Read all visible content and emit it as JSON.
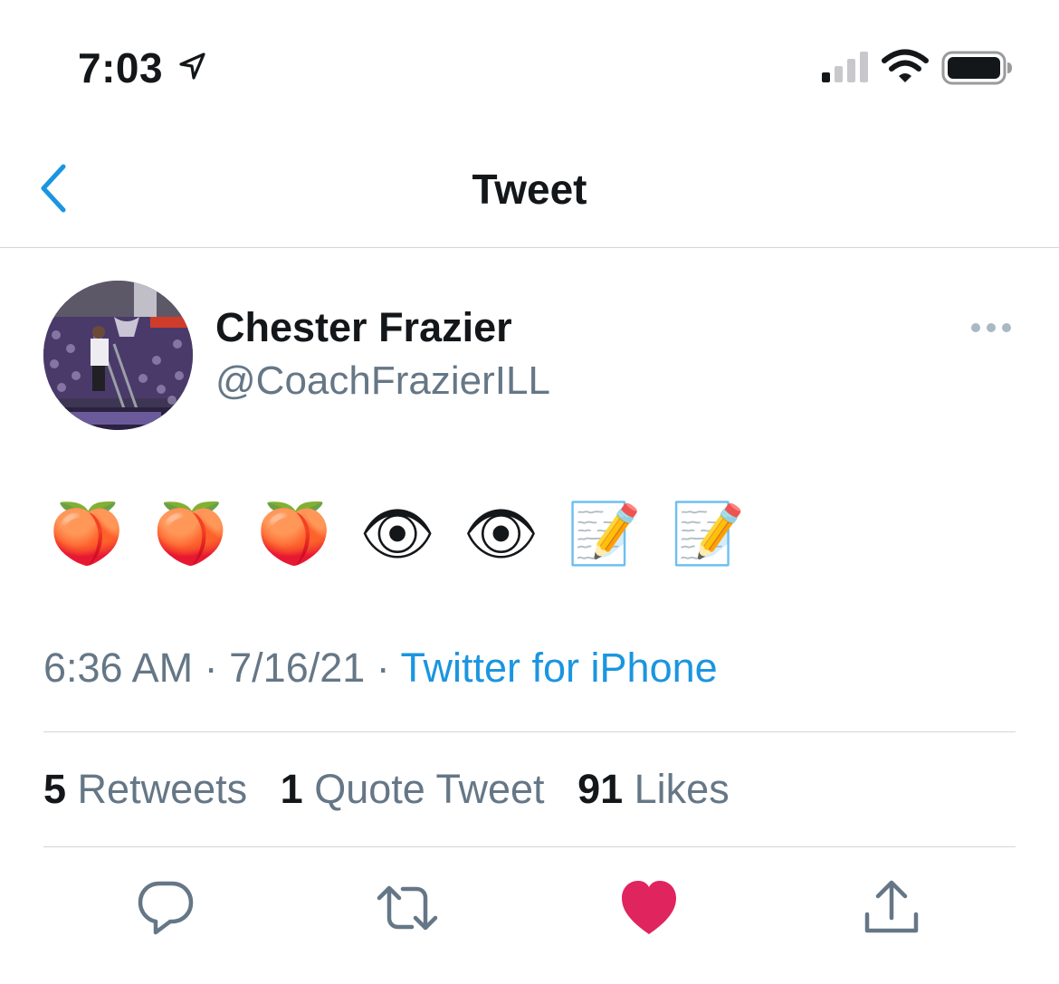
{
  "status_bar": {
    "time": "7:03",
    "location_icon": "location-arrow-icon",
    "signal_icon": "cellular-signal-icon",
    "wifi_icon": "wifi-icon",
    "battery_icon": "battery-icon"
  },
  "nav": {
    "back_icon": "chevron-left-icon",
    "title": "Tweet"
  },
  "tweet": {
    "author": {
      "name": "Chester Frazier",
      "handle": "@CoachFrazierILL"
    },
    "more_icon": "ellipsis-icon",
    "emojis": [
      "🍑",
      "🍑",
      "🍑",
      "👁",
      "👁",
      "📝",
      "📝"
    ],
    "time": "6:36 AM",
    "sep1": "·",
    "date": "7/16/21",
    "sep2": "·",
    "source": "Twitter for iPhone"
  },
  "stats": {
    "retweets_count": "5",
    "retweets_label": "Retweets",
    "quotes_count": "1",
    "quotes_label": "Quote Tweet",
    "likes_count": "91",
    "likes_label": "Likes"
  },
  "actions": {
    "reply_icon": "reply-bubble-icon",
    "retweet_icon": "retweet-icon",
    "like_icon": "heart-filled-icon",
    "share_icon": "share-icon"
  },
  "colors": {
    "accent": "#1b95e0",
    "like": "#e0245e",
    "secondary_text": "#657786",
    "primary_text": "#14171a",
    "divider": "#d2d6da"
  }
}
